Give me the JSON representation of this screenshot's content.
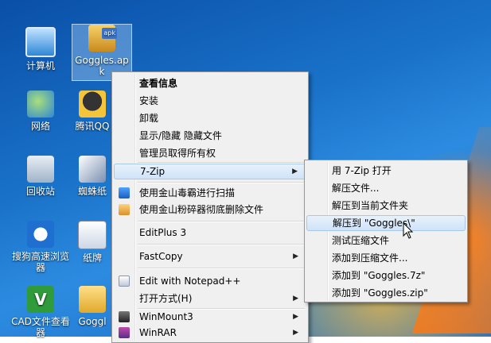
{
  "desktop_icons": [
    {
      "id": "computer",
      "label": "计算机",
      "icon": "computer-icon"
    },
    {
      "id": "apk",
      "label": "Goggles.apk",
      "icon": "apk-file-icon"
    },
    {
      "id": "network",
      "label": "网络",
      "icon": "network-icon"
    },
    {
      "id": "qq",
      "label": "腾讯QQ",
      "icon": "qq-icon"
    },
    {
      "id": "recycle",
      "label": "回收站",
      "icon": "recycle-bin-icon"
    },
    {
      "id": "spider",
      "label": "蜘蛛纸",
      "icon": "spider-solitaire-icon"
    },
    {
      "id": "sogou",
      "label": "搜狗高速浏览器",
      "icon": "sogou-browser-icon"
    },
    {
      "id": "cards",
      "label": "纸牌",
      "icon": "solitaire-icon"
    },
    {
      "id": "cad",
      "label": "CAD文件查看器",
      "icon": "cad-viewer-icon"
    },
    {
      "id": "folder",
      "label": "Goggl",
      "icon": "folder-icon"
    }
  ],
  "context_menu": {
    "items": [
      {
        "label": "查看信息",
        "bold": true
      },
      {
        "label": "安装"
      },
      {
        "label": "卸载"
      },
      {
        "label": "显示/隐藏 隐藏文件"
      },
      {
        "label": "管理员取得所有权"
      },
      {
        "label": "7-Zip",
        "submenu": true,
        "highlighted": true
      },
      {
        "label": "使用金山毒霸进行扫描",
        "icon": "shield-icon"
      },
      {
        "label": "使用金山粉碎器彻底删除文件",
        "icon": "shredder-icon"
      },
      {
        "label": "EditPlus 3"
      },
      {
        "label": "FastCopy",
        "submenu": true
      },
      {
        "label": "Edit with Notepad++",
        "icon": "notepad-icon"
      },
      {
        "label": "打开方式(H)",
        "submenu": true
      },
      {
        "label": "WinMount3",
        "submenu": true,
        "icon": "winmount-icon"
      },
      {
        "label": "WinRAR",
        "submenu": true,
        "icon": "winrar-icon"
      }
    ]
  },
  "submenu_7zip": {
    "items": [
      {
        "label": "用 7-Zip 打开"
      },
      {
        "label": "解压文件..."
      },
      {
        "label": "解压到当前文件夹"
      },
      {
        "label": "解压到 \"Goggles\\\"",
        "highlighted": true
      },
      {
        "label": "测试压缩文件"
      },
      {
        "label": "添加到压缩文件..."
      },
      {
        "label": "添加到 \"Goggles.7z\""
      },
      {
        "label": "添加到 \"Goggles.zip\""
      }
    ]
  },
  "arrow_glyph": "▶"
}
